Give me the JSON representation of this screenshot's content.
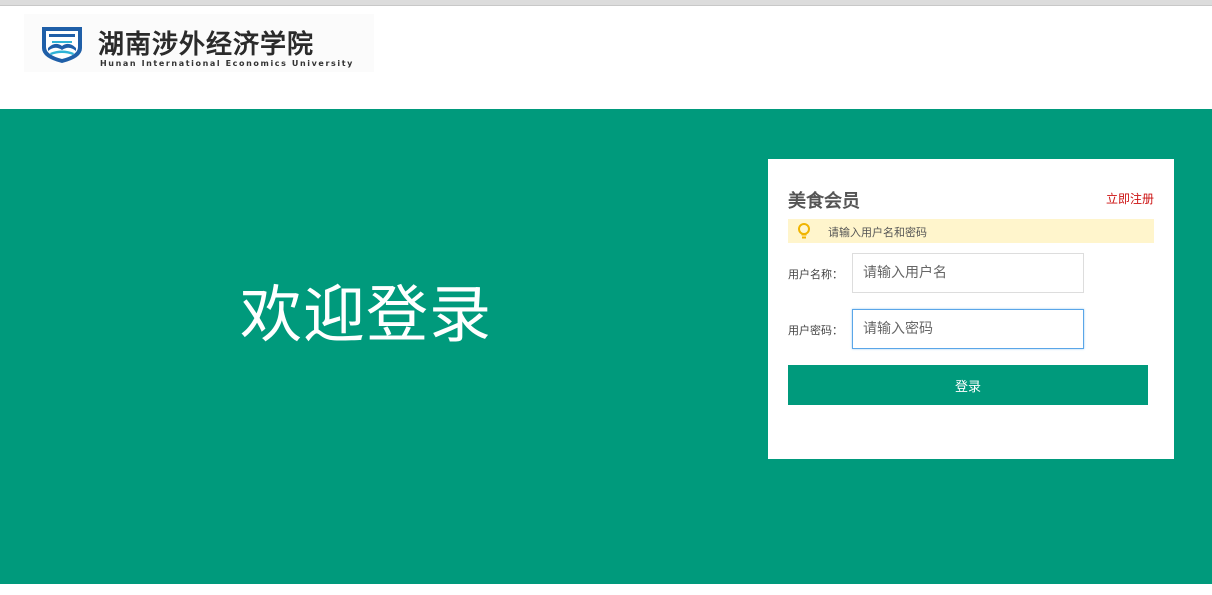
{
  "header": {
    "logo": {
      "name_cn": "湖南涉外经济学院",
      "name_en": "Hunan International Economics University",
      "emblem_icon": "university-emblem-icon"
    }
  },
  "banner": {
    "welcome_text": "欢迎登录",
    "background_color": "#009a7c"
  },
  "login_card": {
    "title": "美食会员",
    "register_link": "立即注册",
    "notice": {
      "icon": "lightbulb-icon",
      "text": "请输入用户名和密码"
    },
    "username": {
      "label": "用户名称：",
      "placeholder": "请输入用户名",
      "value": ""
    },
    "password": {
      "label": "用户密码：",
      "placeholder": "请输入密码",
      "value": ""
    },
    "login_button": "登录"
  },
  "colors": {
    "accent": "#009a7c",
    "link_red": "#cc1111",
    "notice_bg": "#fff5cc",
    "focus_border": "#5aa6e8"
  }
}
